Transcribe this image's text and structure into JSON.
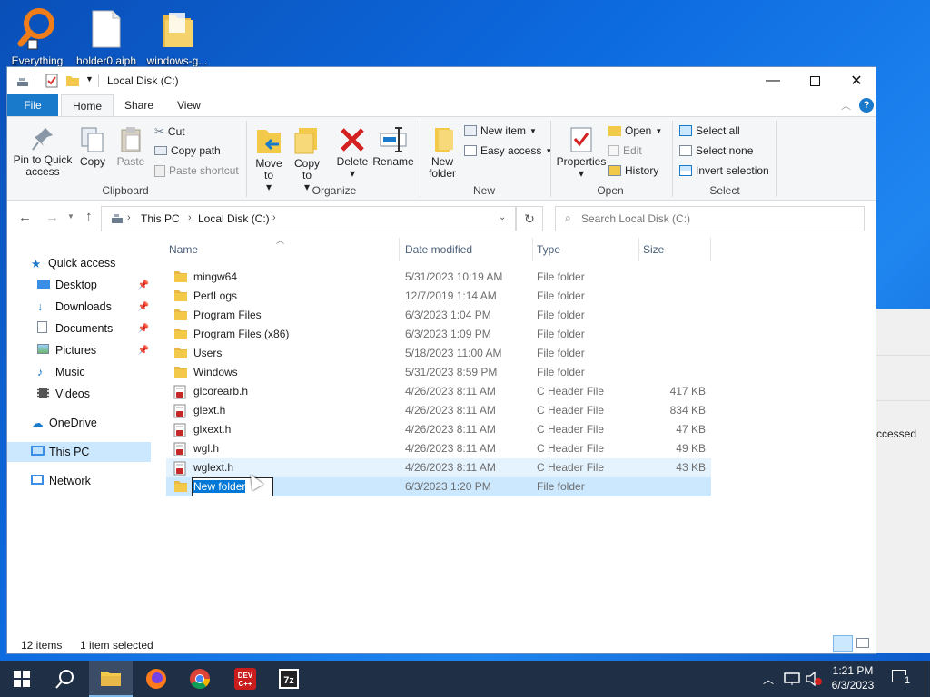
{
  "desktop": {
    "icons": [
      {
        "label": "Everything"
      },
      {
        "label": "holder0.aiph"
      },
      {
        "label": "windows-g..."
      }
    ],
    "bg_partial": {
      "text": "ccessed"
    }
  },
  "window": {
    "title": "Local Disk (C:)",
    "tabs": {
      "file": "File",
      "home": "Home",
      "share": "Share",
      "view": "View"
    },
    "ribbon": {
      "clipboard": {
        "label": "Clipboard",
        "pin": "Pin to Quick access",
        "copy": "Copy",
        "paste": "Paste",
        "cut": "Cut",
        "copy_path": "Copy path",
        "paste_shortcut": "Paste shortcut"
      },
      "organize": {
        "label": "Organize",
        "move_to": "Move to",
        "copy_to": "Copy to",
        "delete": "Delete",
        "rename": "Rename"
      },
      "new": {
        "label": "New",
        "new_folder": "New folder",
        "new_item": "New item",
        "easy_access": "Easy access"
      },
      "open": {
        "label": "Open",
        "properties": "Properties",
        "open": "Open",
        "edit": "Edit",
        "history": "History"
      },
      "select": {
        "label": "Select",
        "select_all": "Select all",
        "select_none": "Select none",
        "invert": "Invert selection"
      }
    },
    "address": {
      "crumbs": [
        "This PC",
        "Local Disk (C:)"
      ],
      "search_placeholder": "Search Local Disk (C:)"
    },
    "nav": [
      {
        "label": "Quick access",
        "pinned": false
      },
      {
        "label": "Desktop",
        "pinned": true
      },
      {
        "label": "Downloads",
        "pinned": true
      },
      {
        "label": "Documents",
        "pinned": true
      },
      {
        "label": "Pictures",
        "pinned": true
      },
      {
        "label": "Music",
        "pinned": false
      },
      {
        "label": "Videos",
        "pinned": false
      },
      {
        "label": "OneDrive",
        "pinned": false
      },
      {
        "label": "This PC",
        "pinned": false
      },
      {
        "label": "Network",
        "pinned": false
      }
    ],
    "columns": {
      "name": "Name",
      "date": "Date modified",
      "type": "Type",
      "size": "Size"
    },
    "files": [
      {
        "name": "mingw64",
        "date": "5/31/2023 10:19 AM",
        "type": "File folder",
        "size": "",
        "kind": "folder"
      },
      {
        "name": "PerfLogs",
        "date": "12/7/2019 1:14 AM",
        "type": "File folder",
        "size": "",
        "kind": "folder"
      },
      {
        "name": "Program Files",
        "date": "6/3/2023 1:04 PM",
        "type": "File folder",
        "size": "",
        "kind": "folder"
      },
      {
        "name": "Program Files (x86)",
        "date": "6/3/2023 1:09 PM",
        "type": "File folder",
        "size": "",
        "kind": "folder"
      },
      {
        "name": "Users",
        "date": "5/18/2023 11:00 AM",
        "type": "File folder",
        "size": "",
        "kind": "folder"
      },
      {
        "name": "Windows",
        "date": "5/31/2023 8:59 PM",
        "type": "File folder",
        "size": "",
        "kind": "folder"
      },
      {
        "name": "glcorearb.h",
        "date": "4/26/2023 8:11 AM",
        "type": "C Header File",
        "size": "417 KB",
        "kind": "header"
      },
      {
        "name": "glext.h",
        "date": "4/26/2023 8:11 AM",
        "type": "C Header File",
        "size": "834 KB",
        "kind": "header"
      },
      {
        "name": "glxext.h",
        "date": "4/26/2023 8:11 AM",
        "type": "C Header File",
        "size": "47 KB",
        "kind": "header"
      },
      {
        "name": "wgl.h",
        "date": "4/26/2023 8:11 AM",
        "type": "C Header File",
        "size": "49 KB",
        "kind": "header"
      },
      {
        "name": "wglext.h",
        "date": "4/26/2023 8:11 AM",
        "type": "C Header File",
        "size": "43 KB",
        "kind": "header"
      },
      {
        "name": "New folder",
        "date": "6/3/2023 1:20 PM",
        "type": "File folder",
        "size": "",
        "kind": "folder"
      }
    ],
    "status": {
      "count": "12 items",
      "selection": "1 item selected"
    }
  },
  "taskbar": {
    "time": "1:21 PM",
    "date": "6/3/2023",
    "notification_count": "1"
  },
  "colors": {
    "accent": "#1979ca",
    "selection": "#cce8ff",
    "folder": "#f3c94a"
  }
}
